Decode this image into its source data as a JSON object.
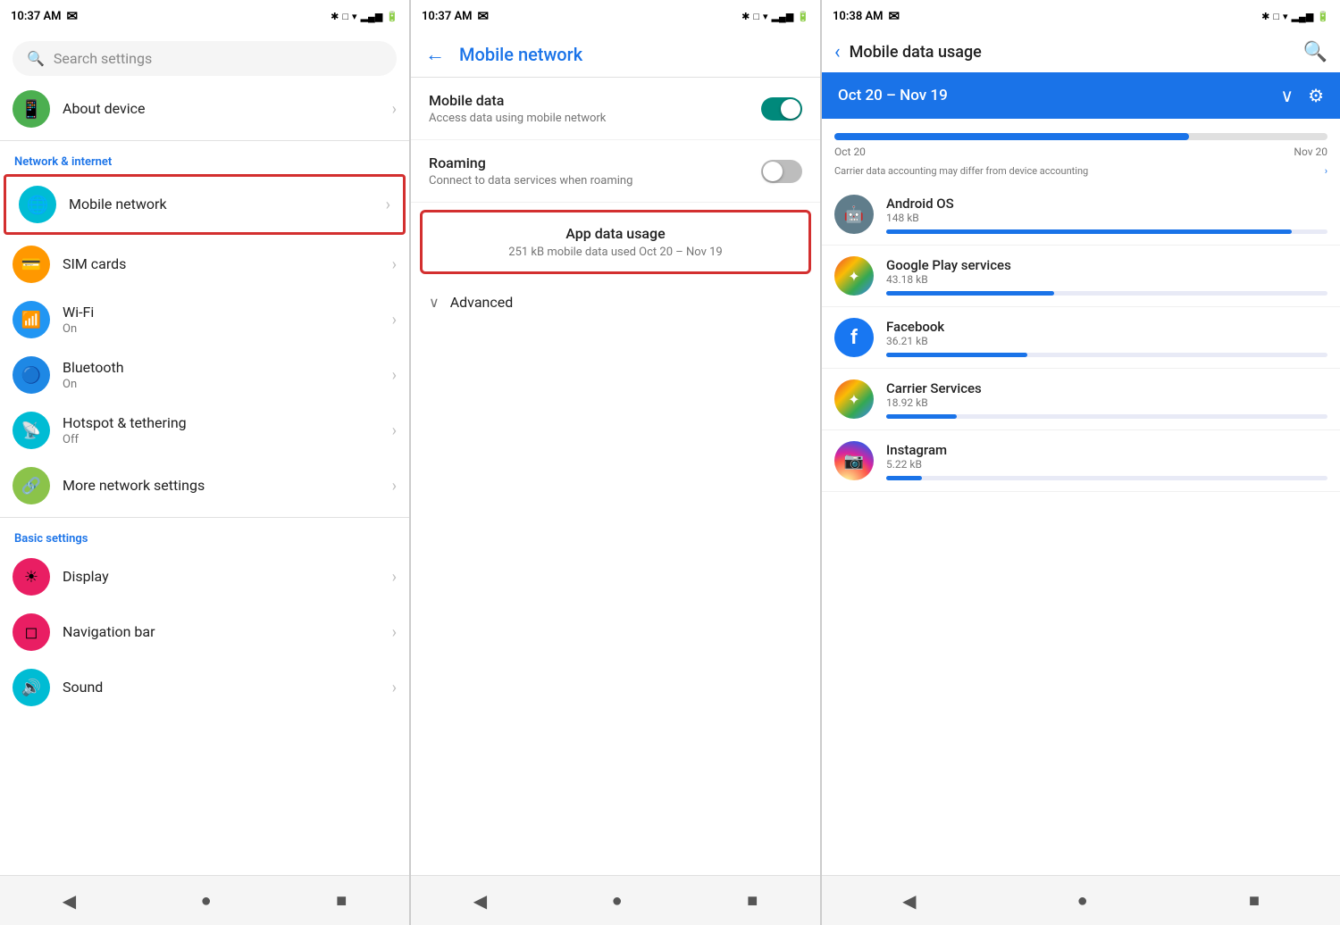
{
  "panel1": {
    "status": {
      "time": "10:37 AM",
      "icons": "✉ ✱ □ ▾ ≡ ▂▄▆ 🔋"
    },
    "search": {
      "placeholder": "Search settings",
      "icon": "🔍"
    },
    "section1_label": "Network & internet",
    "items": [
      {
        "id": "about-device",
        "icon": "📱",
        "icon_color": "icon-green",
        "title": "About device",
        "subtitle": "",
        "highlighted": false
      },
      {
        "id": "mobile-network",
        "icon": "🌐",
        "icon_color": "icon-teal",
        "title": "Mobile network",
        "subtitle": "",
        "highlighted": true
      },
      {
        "id": "sim-cards",
        "icon": "💳",
        "icon_color": "icon-orange",
        "title": "SIM cards",
        "subtitle": "",
        "highlighted": false
      },
      {
        "id": "wifi",
        "icon": "📶",
        "icon_color": "icon-blue",
        "title": "Wi-Fi",
        "subtitle": "On",
        "highlighted": false
      },
      {
        "id": "bluetooth",
        "icon": "🔵",
        "icon_color": "icon-blue",
        "title": "Bluetooth",
        "subtitle": "On",
        "highlighted": false
      },
      {
        "id": "hotspot",
        "icon": "📡",
        "icon_color": "icon-teal",
        "title": "Hotspot & tethering",
        "subtitle": "Off",
        "highlighted": false
      },
      {
        "id": "more-network",
        "icon": "🔗",
        "icon_color": "icon-lime",
        "title": "More network settings",
        "subtitle": "",
        "highlighted": false
      }
    ],
    "section2_label": "Basic settings",
    "items2": [
      {
        "id": "display",
        "icon": "☀",
        "icon_color": "icon-pink",
        "title": "Display",
        "subtitle": "",
        "highlighted": false
      },
      {
        "id": "nav-bar",
        "icon": "◻",
        "icon_color": "icon-pink",
        "title": "Navigation bar",
        "subtitle": "",
        "highlighted": false
      },
      {
        "id": "sound",
        "icon": "🔊",
        "icon_color": "icon-teal",
        "title": "Sound",
        "subtitle": "",
        "highlighted": false
      }
    ],
    "nav": {
      "back": "◀",
      "home": "●",
      "recent": "■"
    }
  },
  "panel2": {
    "status": {
      "time": "10:37 AM",
      "icons": "✉ ✱ □ ▾ ≡ ▂▄▆ 🔋"
    },
    "header": {
      "back": "←",
      "title": "Mobile network"
    },
    "items": [
      {
        "id": "mobile-data",
        "title": "Mobile data",
        "subtitle": "Access data using mobile network",
        "toggle": true,
        "toggle_on": true
      },
      {
        "id": "roaming",
        "title": "Roaming",
        "subtitle": "Connect to data services when roaming",
        "toggle": true,
        "toggle_on": false
      }
    ],
    "app_data": {
      "title": "App data usage",
      "subtitle": "251 kB mobile data used Oct 20 – Nov 19",
      "highlighted": true
    },
    "advanced": {
      "label": "Advanced",
      "chevron": "∨"
    },
    "nav": {
      "back": "◀",
      "home": "●",
      "recent": "■"
    }
  },
  "panel3": {
    "status": {
      "time": "10:38 AM",
      "icons": "✉ □ ▾ ≡ ▂▄▆ 🔋"
    },
    "header": {
      "back": "‹",
      "title": "Mobile data usage",
      "search_icon": "🔍"
    },
    "date_range": {
      "label": "Oct 20 – Nov 19",
      "dropdown": "∨",
      "settings": "⚙"
    },
    "chart": {
      "fill_percent": 72,
      "date_start": "Oct 20",
      "date_end": "Nov 20",
      "note": "Carrier data accounting may differ from device accounting"
    },
    "apps": [
      {
        "id": "android-os",
        "name": "Android OS",
        "size": "148 kB",
        "bar_percent": 92,
        "icon": "🤖",
        "icon_color": "icon-android"
      },
      {
        "id": "google-play",
        "name": "Google Play services",
        "size": "43.18 kB",
        "bar_percent": 38,
        "icon": "✦",
        "icon_color": "icon-carrier"
      },
      {
        "id": "facebook",
        "name": "Facebook",
        "size": "36.21 kB",
        "bar_percent": 32,
        "icon": "f",
        "icon_color": "icon-fb"
      },
      {
        "id": "carrier-services",
        "name": "Carrier Services",
        "size": "18.92 kB",
        "bar_percent": 16,
        "icon": "✦",
        "icon_color": "icon-carrier"
      },
      {
        "id": "instagram",
        "name": "Instagram",
        "size": "5.22 kB",
        "bar_percent": 8,
        "icon": "📷",
        "icon_color": "icon-insta-grad"
      }
    ],
    "nav": {
      "back": "◀",
      "home": "●",
      "recent": "■"
    }
  }
}
